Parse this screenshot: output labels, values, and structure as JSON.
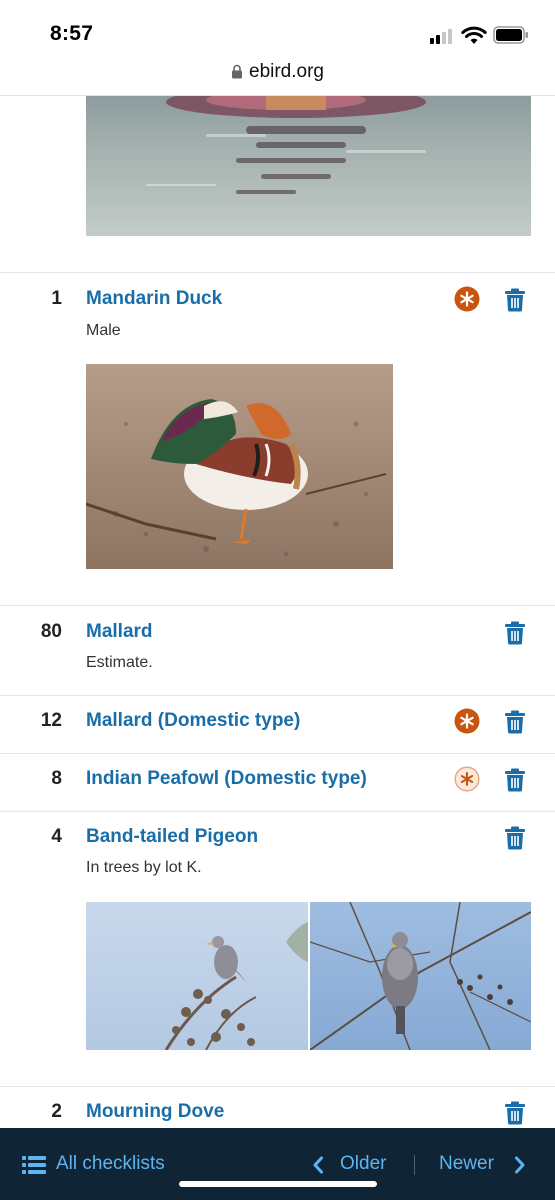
{
  "status_bar": {
    "time": "8:57"
  },
  "browser": {
    "url": "ebird.org"
  },
  "checklist": {
    "rows": [
      {
        "count": "1",
        "name": "Mandarin Duck",
        "note": "Male",
        "flag": "rare-filled"
      },
      {
        "count": "80",
        "name": "Mallard",
        "note": "Estimate.",
        "flag": ""
      },
      {
        "count": "12",
        "name": "Mallard (Domestic type)",
        "note": "",
        "flag": "rare-filled"
      },
      {
        "count": "8",
        "name": "Indian Peafowl (Domestic type)",
        "note": "",
        "flag": "rare-outline"
      },
      {
        "count": "4",
        "name": "Band-tailed Pigeon",
        "note": "In trees by lot K.",
        "flag": ""
      },
      {
        "count": "2",
        "name": "Mourning Dove",
        "note": "",
        "flag": ""
      }
    ]
  },
  "bottom_nav": {
    "all_checklists": "All checklists",
    "older": "Older",
    "newer": "Newer"
  },
  "colors": {
    "link": "#1a6ea8",
    "flag_orange": "#c8540f",
    "nav_bg": "#0f2434",
    "nav_text": "#5fb3f0"
  },
  "icons": [
    "lock-icon",
    "signal-icon",
    "wifi-icon",
    "battery-icon",
    "rare-species-icon",
    "trash-icon",
    "list-icon",
    "chevron-left-icon",
    "chevron-right-icon"
  ]
}
